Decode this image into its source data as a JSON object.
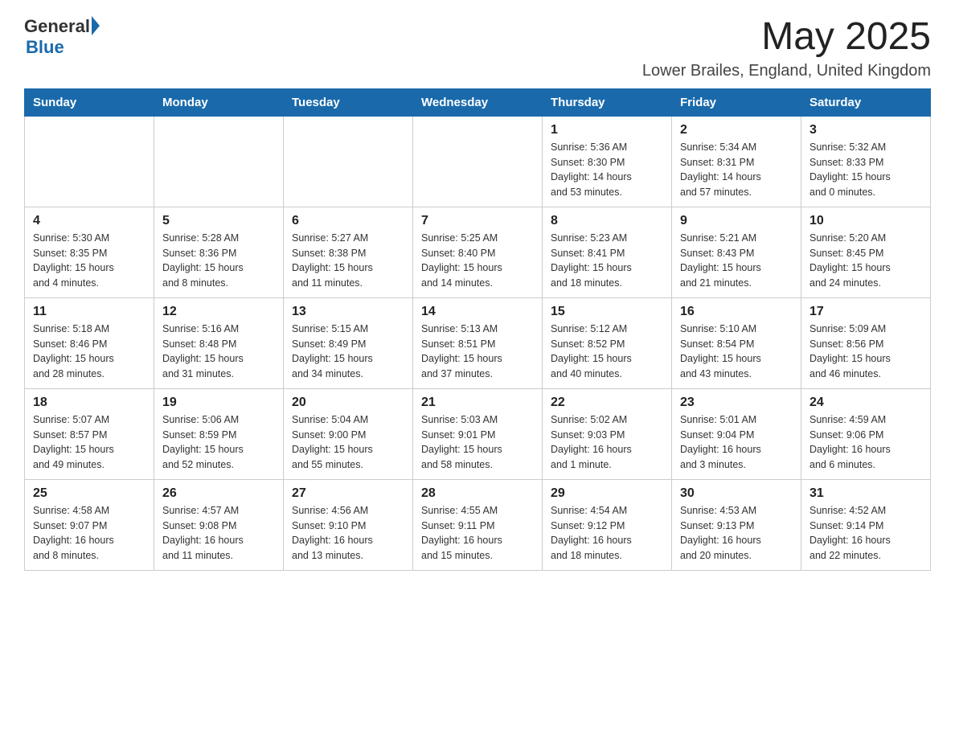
{
  "header": {
    "logo_general": "General",
    "logo_blue": "Blue",
    "month_title": "May 2025",
    "subtitle": "Lower Brailes, England, United Kingdom"
  },
  "calendar": {
    "days_of_week": [
      "Sunday",
      "Monday",
      "Tuesday",
      "Wednesday",
      "Thursday",
      "Friday",
      "Saturday"
    ],
    "weeks": [
      [
        {
          "day": "",
          "info": ""
        },
        {
          "day": "",
          "info": ""
        },
        {
          "day": "",
          "info": ""
        },
        {
          "day": "",
          "info": ""
        },
        {
          "day": "1",
          "info": "Sunrise: 5:36 AM\nSunset: 8:30 PM\nDaylight: 14 hours\nand 53 minutes."
        },
        {
          "day": "2",
          "info": "Sunrise: 5:34 AM\nSunset: 8:31 PM\nDaylight: 14 hours\nand 57 minutes."
        },
        {
          "day": "3",
          "info": "Sunrise: 5:32 AM\nSunset: 8:33 PM\nDaylight: 15 hours\nand 0 minutes."
        }
      ],
      [
        {
          "day": "4",
          "info": "Sunrise: 5:30 AM\nSunset: 8:35 PM\nDaylight: 15 hours\nand 4 minutes."
        },
        {
          "day": "5",
          "info": "Sunrise: 5:28 AM\nSunset: 8:36 PM\nDaylight: 15 hours\nand 8 minutes."
        },
        {
          "day": "6",
          "info": "Sunrise: 5:27 AM\nSunset: 8:38 PM\nDaylight: 15 hours\nand 11 minutes."
        },
        {
          "day": "7",
          "info": "Sunrise: 5:25 AM\nSunset: 8:40 PM\nDaylight: 15 hours\nand 14 minutes."
        },
        {
          "day": "8",
          "info": "Sunrise: 5:23 AM\nSunset: 8:41 PM\nDaylight: 15 hours\nand 18 minutes."
        },
        {
          "day": "9",
          "info": "Sunrise: 5:21 AM\nSunset: 8:43 PM\nDaylight: 15 hours\nand 21 minutes."
        },
        {
          "day": "10",
          "info": "Sunrise: 5:20 AM\nSunset: 8:45 PM\nDaylight: 15 hours\nand 24 minutes."
        }
      ],
      [
        {
          "day": "11",
          "info": "Sunrise: 5:18 AM\nSunset: 8:46 PM\nDaylight: 15 hours\nand 28 minutes."
        },
        {
          "day": "12",
          "info": "Sunrise: 5:16 AM\nSunset: 8:48 PM\nDaylight: 15 hours\nand 31 minutes."
        },
        {
          "day": "13",
          "info": "Sunrise: 5:15 AM\nSunset: 8:49 PM\nDaylight: 15 hours\nand 34 minutes."
        },
        {
          "day": "14",
          "info": "Sunrise: 5:13 AM\nSunset: 8:51 PM\nDaylight: 15 hours\nand 37 minutes."
        },
        {
          "day": "15",
          "info": "Sunrise: 5:12 AM\nSunset: 8:52 PM\nDaylight: 15 hours\nand 40 minutes."
        },
        {
          "day": "16",
          "info": "Sunrise: 5:10 AM\nSunset: 8:54 PM\nDaylight: 15 hours\nand 43 minutes."
        },
        {
          "day": "17",
          "info": "Sunrise: 5:09 AM\nSunset: 8:56 PM\nDaylight: 15 hours\nand 46 minutes."
        }
      ],
      [
        {
          "day": "18",
          "info": "Sunrise: 5:07 AM\nSunset: 8:57 PM\nDaylight: 15 hours\nand 49 minutes."
        },
        {
          "day": "19",
          "info": "Sunrise: 5:06 AM\nSunset: 8:59 PM\nDaylight: 15 hours\nand 52 minutes."
        },
        {
          "day": "20",
          "info": "Sunrise: 5:04 AM\nSunset: 9:00 PM\nDaylight: 15 hours\nand 55 minutes."
        },
        {
          "day": "21",
          "info": "Sunrise: 5:03 AM\nSunset: 9:01 PM\nDaylight: 15 hours\nand 58 minutes."
        },
        {
          "day": "22",
          "info": "Sunrise: 5:02 AM\nSunset: 9:03 PM\nDaylight: 16 hours\nand 1 minute."
        },
        {
          "day": "23",
          "info": "Sunrise: 5:01 AM\nSunset: 9:04 PM\nDaylight: 16 hours\nand 3 minutes."
        },
        {
          "day": "24",
          "info": "Sunrise: 4:59 AM\nSunset: 9:06 PM\nDaylight: 16 hours\nand 6 minutes."
        }
      ],
      [
        {
          "day": "25",
          "info": "Sunrise: 4:58 AM\nSunset: 9:07 PM\nDaylight: 16 hours\nand 8 minutes."
        },
        {
          "day": "26",
          "info": "Sunrise: 4:57 AM\nSunset: 9:08 PM\nDaylight: 16 hours\nand 11 minutes."
        },
        {
          "day": "27",
          "info": "Sunrise: 4:56 AM\nSunset: 9:10 PM\nDaylight: 16 hours\nand 13 minutes."
        },
        {
          "day": "28",
          "info": "Sunrise: 4:55 AM\nSunset: 9:11 PM\nDaylight: 16 hours\nand 15 minutes."
        },
        {
          "day": "29",
          "info": "Sunrise: 4:54 AM\nSunset: 9:12 PM\nDaylight: 16 hours\nand 18 minutes."
        },
        {
          "day": "30",
          "info": "Sunrise: 4:53 AM\nSunset: 9:13 PM\nDaylight: 16 hours\nand 20 minutes."
        },
        {
          "day": "31",
          "info": "Sunrise: 4:52 AM\nSunset: 9:14 PM\nDaylight: 16 hours\nand 22 minutes."
        }
      ]
    ]
  }
}
